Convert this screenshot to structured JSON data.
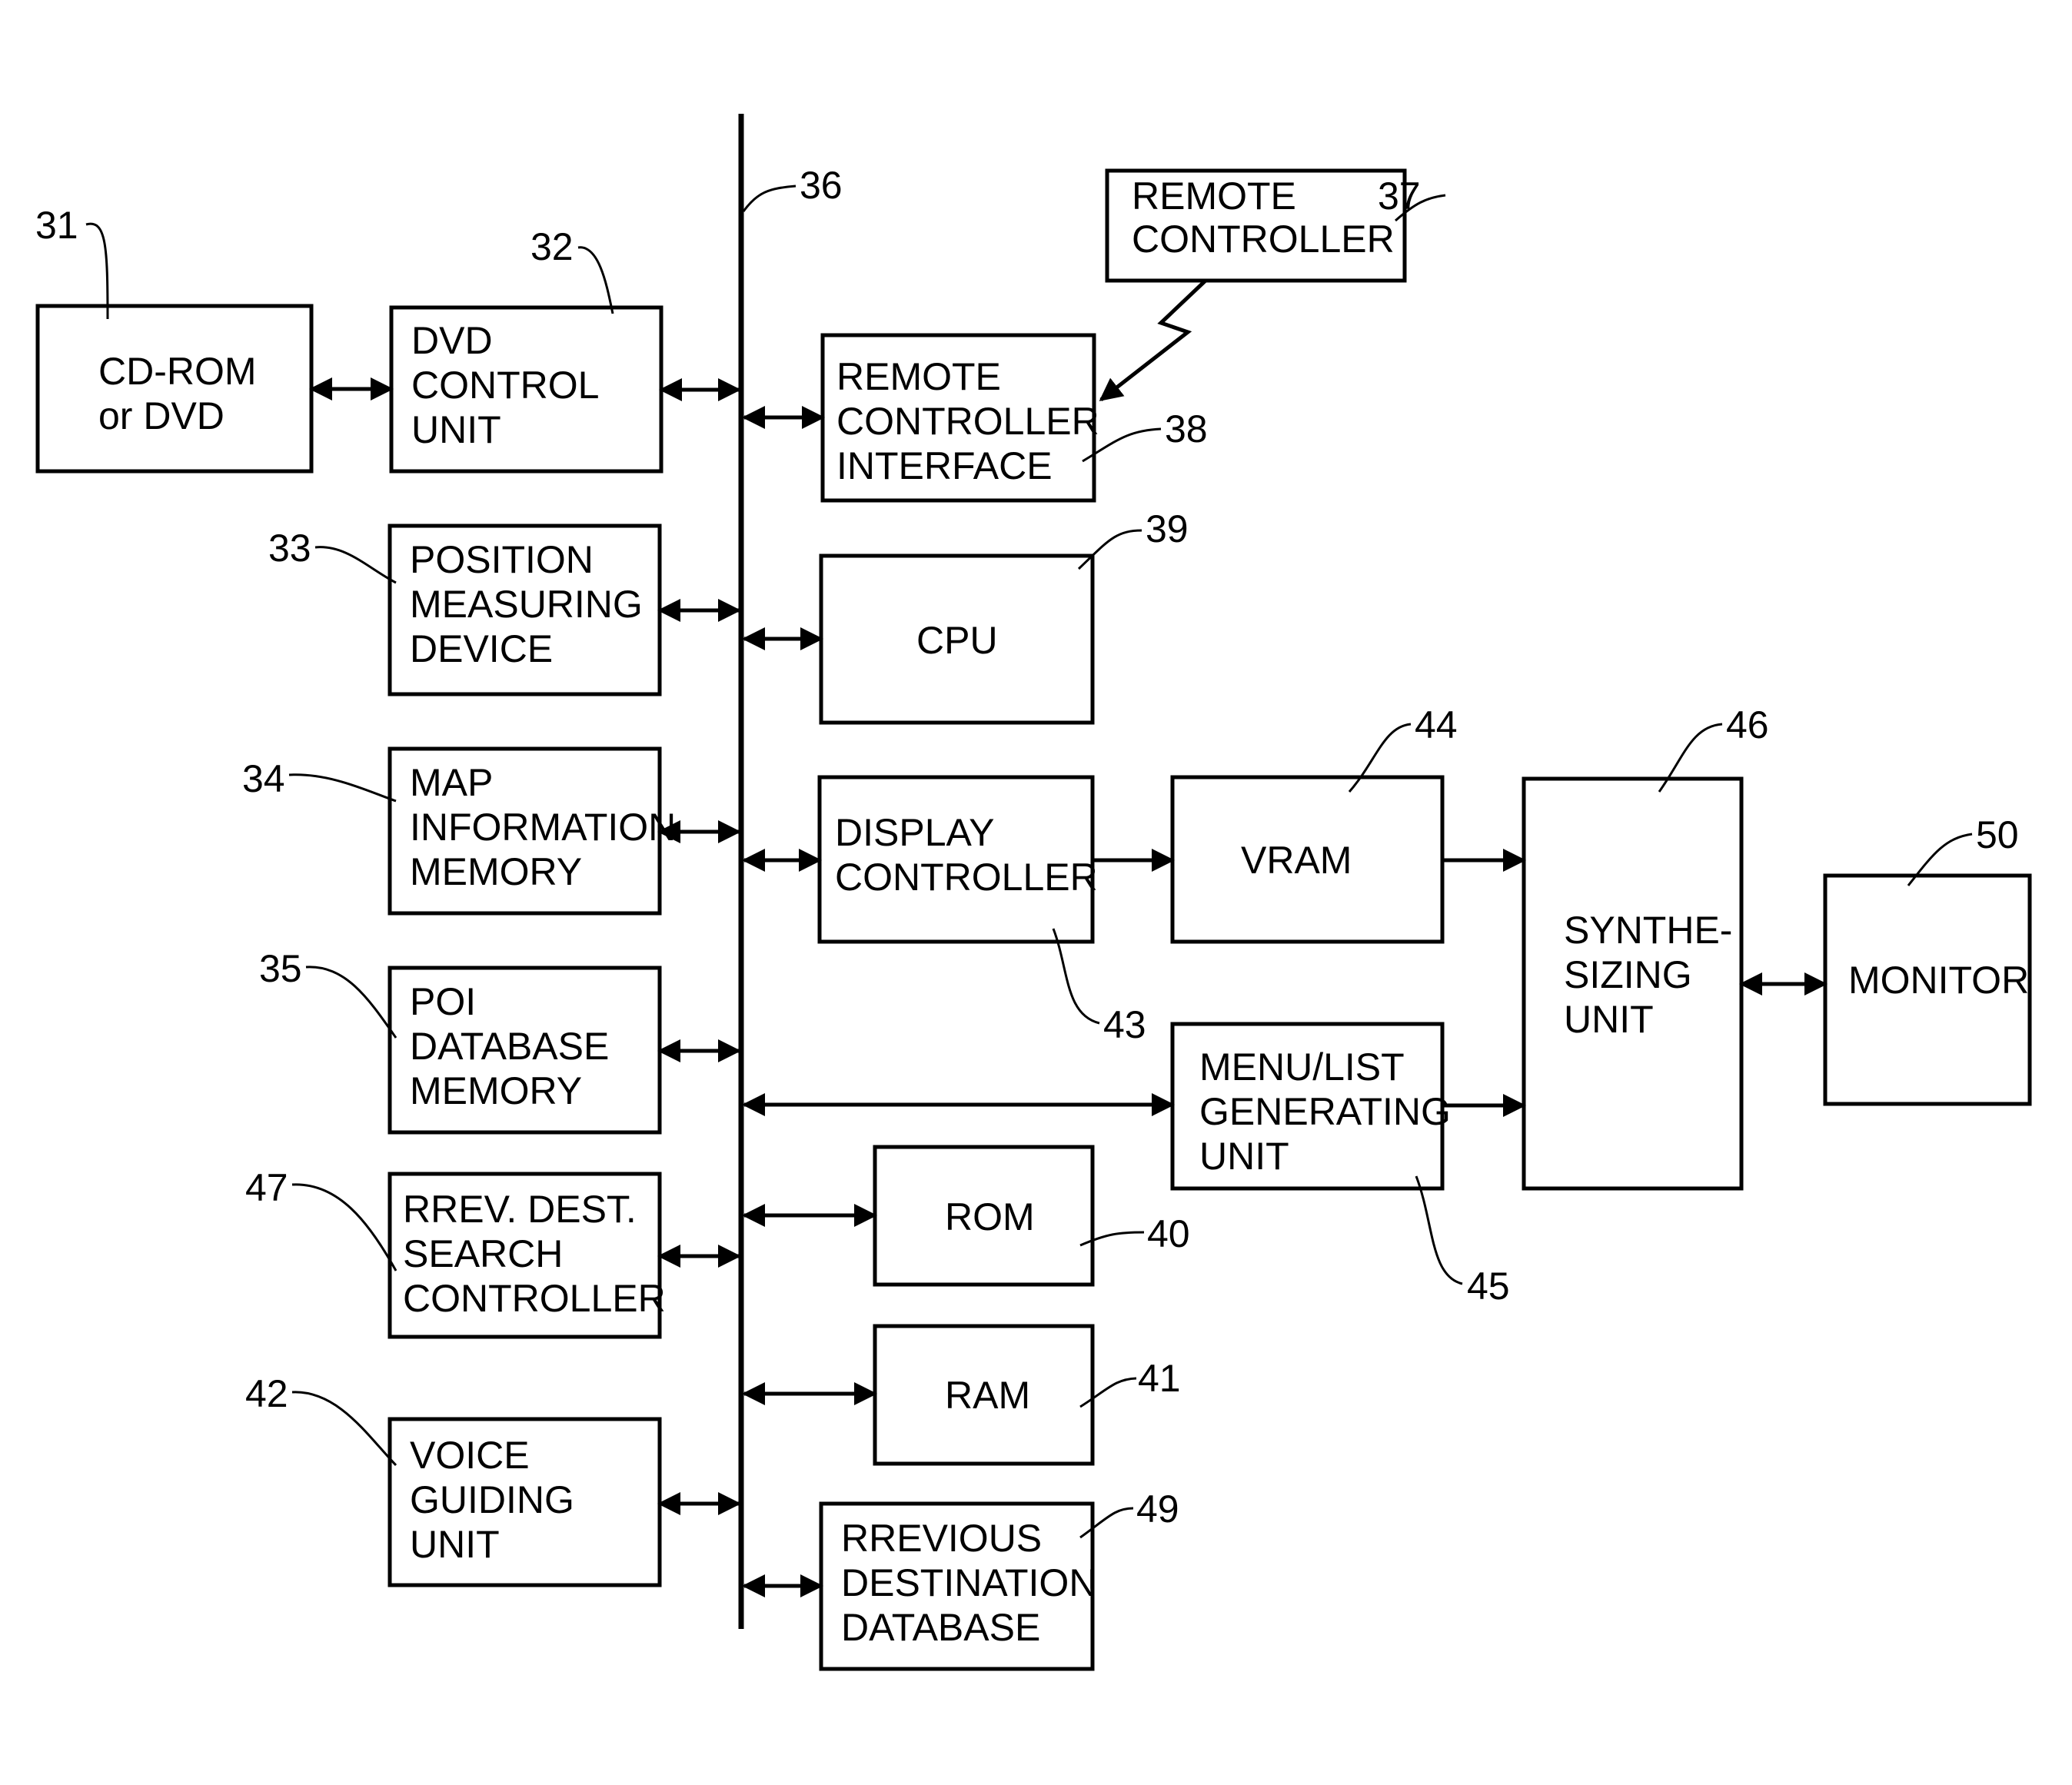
{
  "diagram": {
    "bus_ref": "36",
    "blocks": [
      {
        "id": "31",
        "ref": "31",
        "lines": [
          "CD-ROM",
          "or DVD"
        ]
      },
      {
        "id": "32",
        "ref": "32",
        "lines": [
          "DVD",
          "CONTROL",
          "UNIT"
        ]
      },
      {
        "id": "33",
        "ref": "33",
        "lines": [
          "POSITION",
          "MEASURING",
          "DEVICE"
        ]
      },
      {
        "id": "34",
        "ref": "34",
        "lines": [
          "MAP",
          "INFORMATION",
          "MEMORY"
        ]
      },
      {
        "id": "35",
        "ref": "35",
        "lines": [
          "POI",
          "DATABASE",
          "MEMORY"
        ]
      },
      {
        "id": "47",
        "ref": "47",
        "lines": [
          "RREV. DEST.",
          "SEARCH",
          "CONTROLLER"
        ]
      },
      {
        "id": "42",
        "ref": "42",
        "lines": [
          "VOICE",
          "GUIDING",
          "UNIT"
        ]
      },
      {
        "id": "37",
        "ref": "37",
        "lines": [
          "REMOTE",
          "CONTROLLER"
        ]
      },
      {
        "id": "38",
        "ref": "38",
        "lines": [
          "REMOTE",
          "CONTROLLER",
          "INTERFACE"
        ]
      },
      {
        "id": "39",
        "ref": "39",
        "lines": [
          "CPU"
        ]
      },
      {
        "id": "43",
        "ref": "43",
        "lines": [
          "DISPLAY",
          "CONTROLLER"
        ]
      },
      {
        "id": "44",
        "ref": "44",
        "lines": [
          "VRAM"
        ]
      },
      {
        "id": "45",
        "ref": "45",
        "lines": [
          "MENU/LIST",
          "GENERATING",
          "UNIT"
        ]
      },
      {
        "id": "46",
        "ref": "46",
        "lines": [
          "SYNTHE-",
          "SIZING",
          "UNIT"
        ]
      },
      {
        "id": "50",
        "ref": "50",
        "lines": [
          "MONITOR"
        ]
      },
      {
        "id": "40",
        "ref": "40",
        "lines": [
          "ROM"
        ]
      },
      {
        "id": "41",
        "ref": "41",
        "lines": [
          "RAM"
        ]
      },
      {
        "id": "49",
        "ref": "49",
        "lines": [
          "RREVIOUS",
          "DESTINATION",
          "DATABASE"
        ]
      }
    ],
    "connections": [
      {
        "from": "31",
        "to": "32",
        "type": "bidirectional"
      },
      {
        "from": "32",
        "to": "36",
        "type": "bidirectional"
      },
      {
        "from": "33",
        "to": "36",
        "type": "bidirectional"
      },
      {
        "from": "34",
        "to": "36",
        "type": "bidirectional"
      },
      {
        "from": "35",
        "to": "36",
        "type": "bidirectional"
      },
      {
        "from": "47",
        "to": "36",
        "type": "bidirectional"
      },
      {
        "from": "42",
        "to": "36",
        "type": "bidirectional"
      },
      {
        "from": "36",
        "to": "38",
        "type": "bidirectional"
      },
      {
        "from": "37",
        "to": "38",
        "type": "wireless"
      },
      {
        "from": "36",
        "to": "39",
        "type": "bidirectional"
      },
      {
        "from": "36",
        "to": "43",
        "type": "bidirectional"
      },
      {
        "from": "43",
        "to": "44",
        "type": "directed"
      },
      {
        "from": "44",
        "to": "46",
        "type": "directed"
      },
      {
        "from": "36",
        "to": "45",
        "type": "bidirectional"
      },
      {
        "from": "45",
        "to": "46",
        "type": "directed"
      },
      {
        "from": "46",
        "to": "50",
        "type": "bidirectional"
      },
      {
        "from": "36",
        "to": "40",
        "type": "bidirectional"
      },
      {
        "from": "36",
        "to": "41",
        "type": "bidirectional"
      },
      {
        "from": "36",
        "to": "49",
        "type": "bidirectional"
      }
    ]
  }
}
